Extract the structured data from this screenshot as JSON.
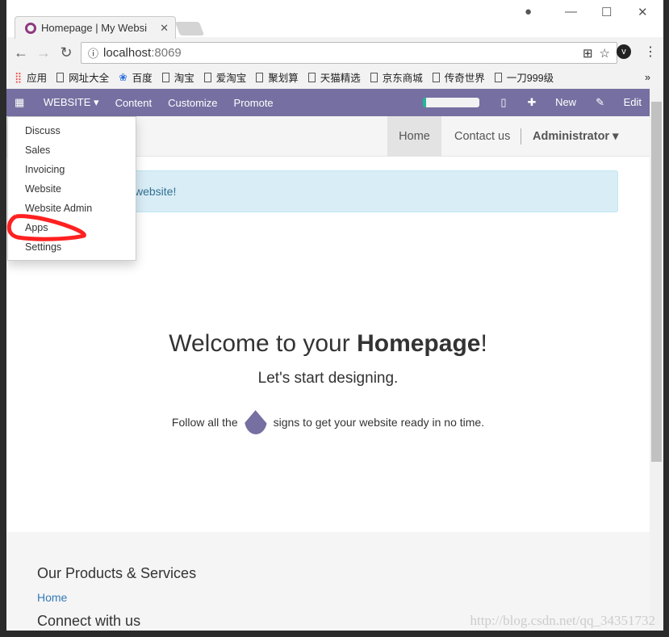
{
  "browser": {
    "tab_title": "Homepage | My Websi",
    "url_host": "localhost",
    "url_port": ":8069",
    "bookmarks": [
      "应用",
      "网址大全",
      "百度",
      "淘宝",
      "爱淘宝",
      "聚划算",
      "天猫精选",
      "京东商城",
      "传奇世界",
      "一刀999级"
    ],
    "more": "»"
  },
  "odoo_nav": {
    "app": "WEBSITE",
    "items": [
      "Content",
      "Customize",
      "Promote"
    ],
    "new": "New",
    "edit": "Edit"
  },
  "header": {
    "home": "Home",
    "contact": "Contact us",
    "user": "Administrator"
  },
  "menu": [
    "Discuss",
    "Sales",
    "Invoicing",
    "Website",
    "Website Admin",
    "Apps",
    "Settings"
  ],
  "alert": "website!",
  "hero": {
    "title_pre": "Welcome to your ",
    "title_bold": "Homepage",
    "title_post": "!",
    "subtitle": "Let's start designing.",
    "follow_pre": "Follow all the",
    "follow_post": "signs to get your website ready in no time."
  },
  "footer": {
    "products": "Our Products & Services",
    "home_link": "Home",
    "connect": "Connect with us"
  },
  "watermark": "http://blog.csdn.net/qq_34351732",
  "colors": {
    "nav": "#7570a1",
    "annotation": "#ff2020"
  }
}
